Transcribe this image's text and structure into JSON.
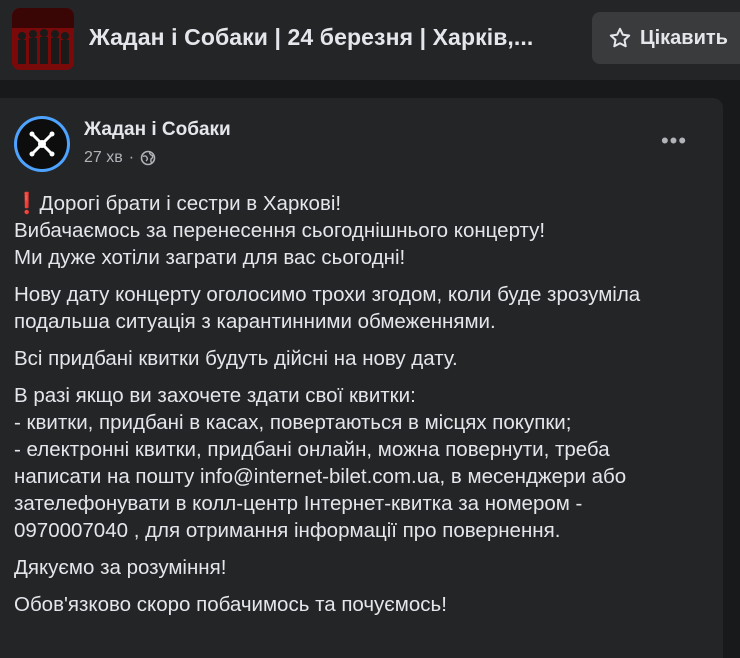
{
  "event_header": {
    "title": "Жадан і Собаки | 24 березня | Харків,...",
    "interested_label": "Цікавить"
  },
  "post": {
    "author": "Жадан і Собаки",
    "timestamp": "27 хв",
    "separator": "·",
    "more_label": "•••",
    "paragraphs": [
      {
        "lines": [
          "Дорогі брати і сестри в Харкові!",
          "Вибачаємось за перенесення сьогоднішнього концерту!",
          "Ми дуже хотіли заграти для вас сьогодні!"
        ]
      },
      {
        "lines": [
          "Нову дату концерту оголосимо трохи згодом, коли буде зрозуміла",
          "подальша ситуація з карантинними обмеженнями."
        ]
      },
      {
        "lines": [
          "Всі придбані квитки будуть дійсні на нову дату."
        ]
      },
      {
        "lines": [
          "В разі якщо ви захочете здати свої квитки:",
          "- квитки, придбані в касах, повертаються в місцях покупки;",
          "- електронні квитки, придбані онлайн, можна повернути, треба",
          "написати на пошту info@internet-bilet.com.ua, в месенджери або",
          "зателефонувати в колл-центр Інтернет-квитка за номером -",
          "0970007040 , для отримання інформації про повернення."
        ]
      },
      {
        "lines": [
          "Дякуємо за розуміння!"
        ]
      },
      {
        "lines": [
          "Обов'язково скоро побачимось та почуємось!"
        ]
      }
    ],
    "exclamation_emoji": "❗"
  }
}
